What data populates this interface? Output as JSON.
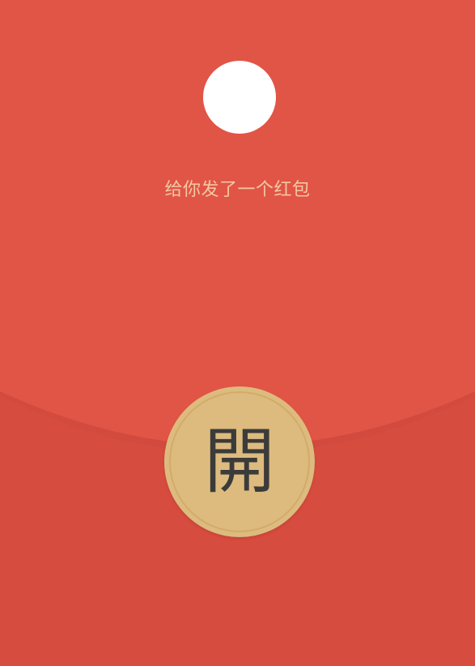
{
  "envelope": {
    "greeting": "给你发了一个红包",
    "open_button_label": "開"
  },
  "colors": {
    "flap": "#e15546",
    "body": "#d64d3f",
    "greeting_text": "#f4c7a2",
    "button": "#ddbb7e",
    "button_text": "#3b3b3b",
    "avatar": "#ffffff"
  },
  "icons": {
    "avatar": "avatar-placeholder-circle"
  }
}
